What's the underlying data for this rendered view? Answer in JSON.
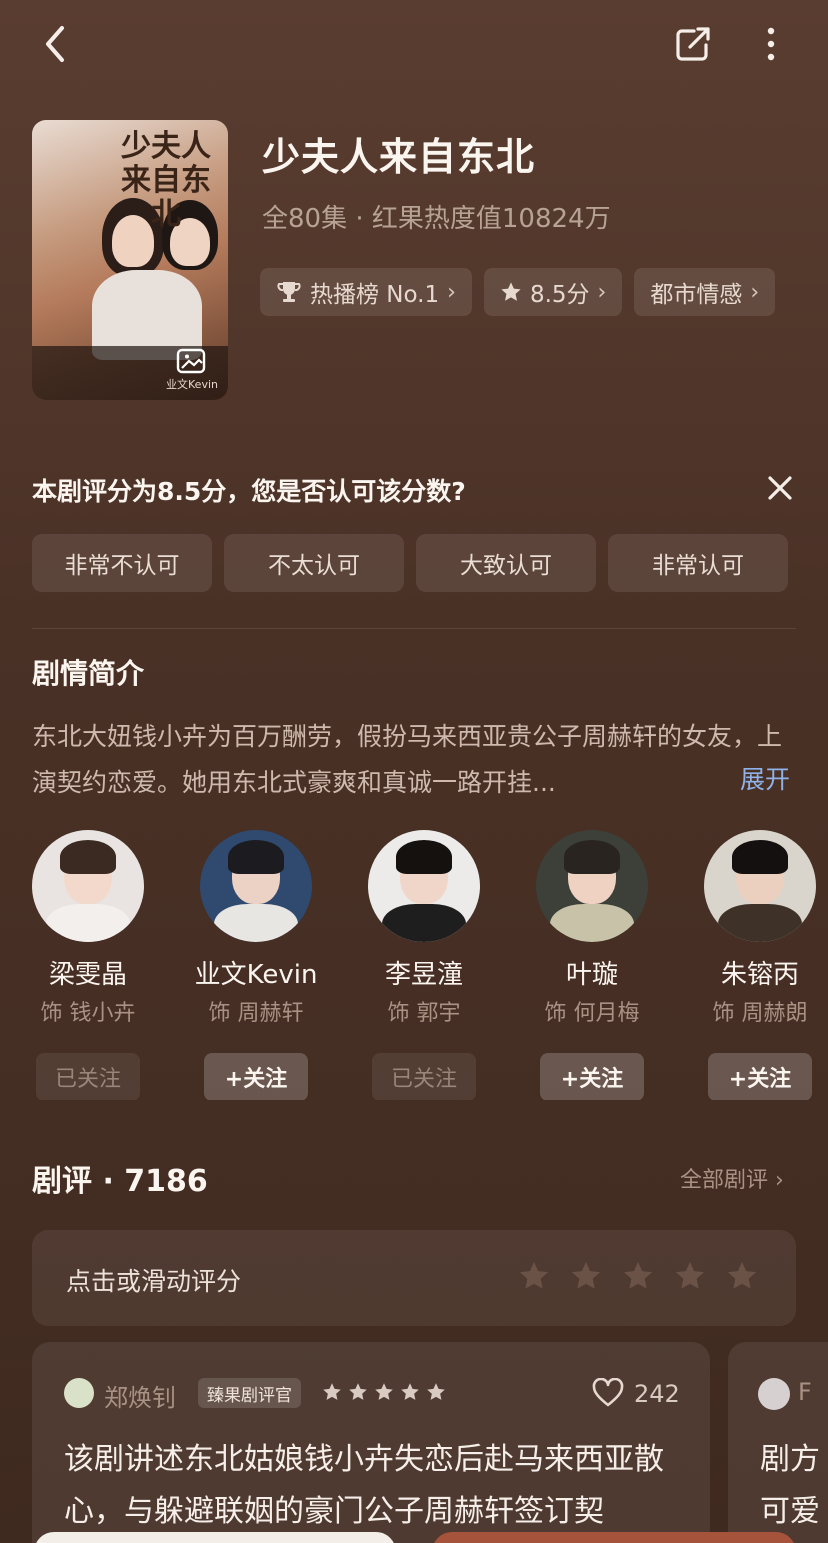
{
  "show": {
    "title": "少夫人来自东北",
    "meta": "全80集 · 红果热度值10824万",
    "poster_title": "少夫人来自东北",
    "poster_credit": "业文Kevin",
    "chips": [
      {
        "icon": "trophy-icon",
        "label": "热播榜 No.1"
      },
      {
        "icon": "star-icon",
        "label": "8.5分"
      },
      {
        "icon": "",
        "label": "都市情感"
      }
    ]
  },
  "rating_prompt": {
    "question": "本剧评分为8.5分，您是否认可该分数?",
    "options": [
      "非常不认可",
      "不太认可",
      "大致认可",
      "非常认可"
    ]
  },
  "synopsis": {
    "heading": "剧情简介",
    "text": "东北大妞钱小卉为百万酬劳，假扮马来西亚贵公子周赫轩的女友，上演契约恋爱。她用东北式豪爽和真诚一路开挂...",
    "expand_label": "展开"
  },
  "cast": [
    {
      "name": "梁雯晶",
      "role": "饰 钱小卉",
      "follow": "已关注",
      "followed": true
    },
    {
      "name": "业文Kevin",
      "role": "饰 周赫轩",
      "follow": "+关注",
      "followed": false
    },
    {
      "name": "李昱潼",
      "role": "饰 郭宇",
      "follow": "已关注",
      "followed": true
    },
    {
      "name": "叶璇",
      "role": "饰 何月梅",
      "follow": "+关注",
      "followed": false
    },
    {
      "name": "朱镕丙",
      "role": "饰 周赫朗",
      "follow": "+关注",
      "followed": false
    }
  ],
  "reviews": {
    "heading": "剧评 · 7186",
    "all_label": "全部剧评 ›",
    "rate_label": "点击或滑动评分",
    "items": [
      {
        "user": "郑焕钊",
        "badge": "臻果剧评官",
        "stars": 5,
        "likes": "242",
        "text": "该剧讲述东北姑娘钱小卉失恋后赴马来西亚散心，与躲避联姻的豪门公子周赫轩签订契"
      },
      {
        "user": "F",
        "text": "剧方可爱"
      }
    ]
  },
  "colors": {
    "background": "#4a3126",
    "accent_link": "#8fb2e8"
  }
}
